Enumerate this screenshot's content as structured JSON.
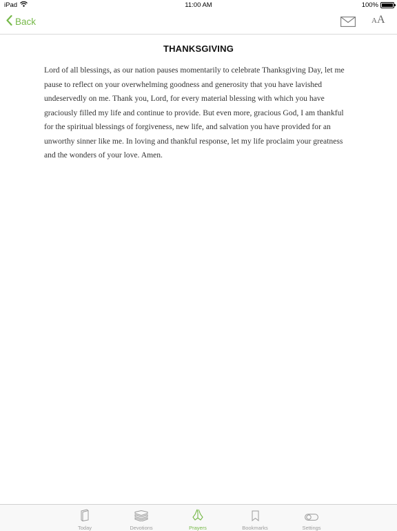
{
  "status_bar": {
    "device": "iPad",
    "time": "11:00 AM",
    "battery_text": "100%",
    "battery_level": 1.0
  },
  "nav": {
    "back_label": "Back",
    "font_small": "A",
    "font_big": "A"
  },
  "article": {
    "title": "THANKSGIVING",
    "body": "Lord of all blessings, as our nation pauses momentarily to celebrate Thanksgiving Day, let me pause to reflect on your overwhelming goodness and generosity that you have lavished undeservedly on me. Thank you, Lord, for every material blessing with which you have graciously filled my life and continue to provide. But even more, gracious God, I am thankful for the spiritual blessings of forgiveness, new life, and salvation you have provided for an unworthy sinner like me. In loving and thankful response, let my life proclaim your greatness and the wonders of your love. Amen."
  },
  "tabs": [
    {
      "label": "Today",
      "icon": "book-icon",
      "active": false
    },
    {
      "label": "Devotions",
      "icon": "books-stack-icon",
      "active": false
    },
    {
      "label": "Prayers",
      "icon": "praying-hands-icon",
      "active": true
    },
    {
      "label": "Bookmarks",
      "icon": "bookmark-icon",
      "active": false
    },
    {
      "label": "Settings",
      "icon": "toggle-switch-icon",
      "active": false
    }
  ],
  "colors": {
    "accent": "#77b94a",
    "inactive": "#9b9b9b",
    "divider": "#d8d8d8"
  }
}
